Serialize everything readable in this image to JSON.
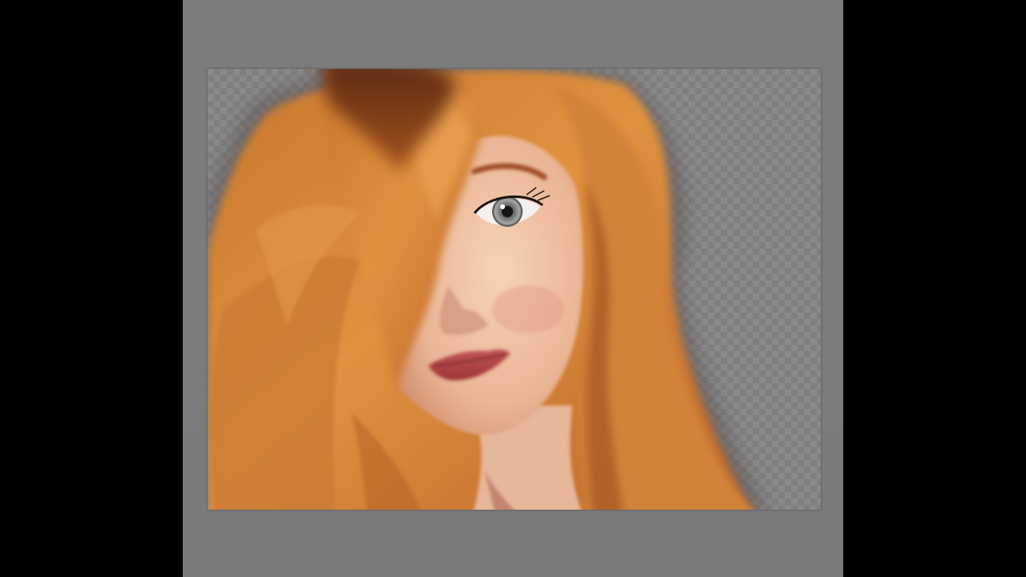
{
  "app": {
    "window_title": "",
    "view": "painting-canvas"
  },
  "canvas": {
    "background": "transparency-checkerboard",
    "subject": "portrait-painting"
  },
  "colors": {
    "workspace": "#7b7b7b",
    "letterbox": "#000000",
    "hair_main": "#d9883c",
    "hair_dark": "#8a3f14",
    "skin": "#f0c4a3",
    "lips": "#b84a4a",
    "iris": "#8d8d8d"
  }
}
